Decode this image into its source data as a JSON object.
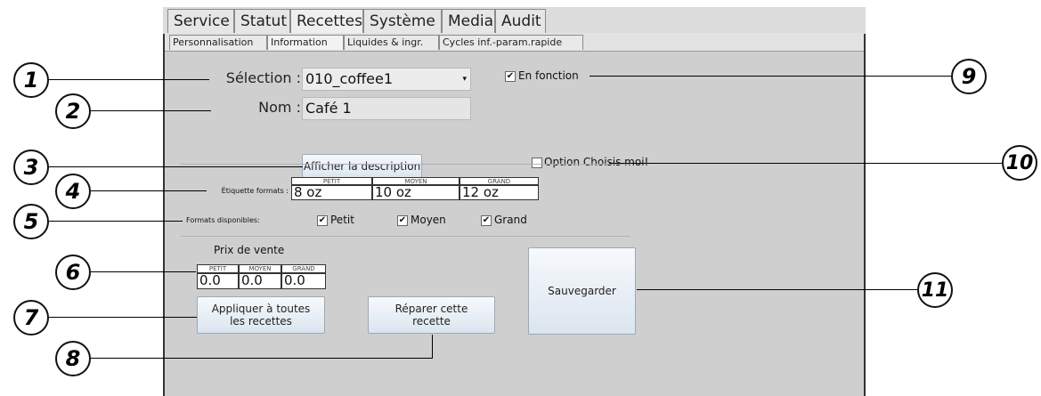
{
  "tabs": [
    "Service",
    "Statut",
    "Recettes",
    "Système",
    "Media",
    "Audit"
  ],
  "subtabs": [
    "Personnalisation",
    "Information",
    "Liquides & ingr.",
    "Cycles inf.-param.rapide"
  ],
  "selection": {
    "label": "Sélection :",
    "value": "010_coffee1"
  },
  "nom": {
    "label": "Nom :",
    "value": "Café 1"
  },
  "description_button": "Afficher la description",
  "en_fonction": {
    "label": "En fonction",
    "checked": true
  },
  "option_choisis": {
    "label": "Option Choisis moi!",
    "checked": false
  },
  "etiquette": {
    "label": "Étiquette formats :",
    "headers": [
      "PETIT",
      "MOYEN",
      "GRAND"
    ],
    "values": [
      "8 oz",
      "10 oz",
      "12 oz"
    ]
  },
  "formats_disponibles": {
    "label": "Formats disponibles:",
    "options": [
      {
        "label": "Petit",
        "checked": true
      },
      {
        "label": "Moyen",
        "checked": true
      },
      {
        "label": "Grand",
        "checked": true
      }
    ]
  },
  "prix": {
    "title": "Prix de vente",
    "headers": [
      "PETIT",
      "MOYEN",
      "GRAND"
    ],
    "values": [
      "0.0",
      "0.0",
      "0.0"
    ]
  },
  "apply_button": {
    "line1": "Appliquer à toutes",
    "line2": "les recettes"
  },
  "repair_button": {
    "line1": "Réparer cette",
    "line2": "recette"
  },
  "save_button": "Sauvegarder",
  "callouts": [
    "1",
    "2",
    "3",
    "4",
    "5",
    "6",
    "7",
    "8",
    "9",
    "10",
    "11"
  ],
  "check_glyph": "✔"
}
